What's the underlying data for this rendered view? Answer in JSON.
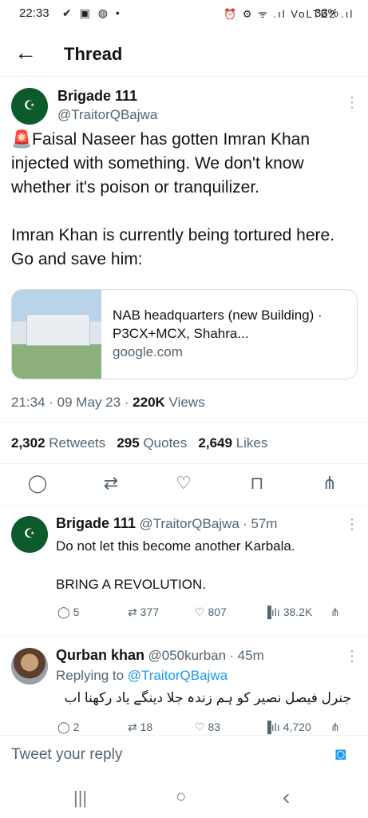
{
  "status_bar": {
    "time": "22:33",
    "left_icons": "✔ ▣ ◍ •",
    "right_icons": "⏰ ⚙ ᯤ .ıl VoLTE2 .ıl",
    "battery": "33%"
  },
  "header": {
    "back_icon": "arrow-left",
    "title": "Thread"
  },
  "main_tweet": {
    "avatar_text": "☪",
    "name": "Brigade 111",
    "handle": "@TraitorQBajwa",
    "text": "🚨Faisal Naseer has gotten Imran Khan injected with something. We don't know whether it's poison or tranquilizer.\n\nImran Khan is currently being tortured here. Go and save him:",
    "card": {
      "title": "NAB headquarters (new Building) · P3CX+MCX, Shahra...",
      "domain": "google.com"
    },
    "time": "21:34",
    "date": "09 May 23",
    "views_count": "220K",
    "views_label": "Views",
    "retweets_count": "2,302",
    "retweets_label": "Retweets",
    "quotes_count": "295",
    "quotes_label": "Quotes",
    "likes_count": "2,649",
    "likes_label": "Likes"
  },
  "reply1": {
    "name": "Brigade 111",
    "handle": "@TraitorQBajwa",
    "age": "57m",
    "text": "Do not let this become another Karbala.\n\nBRING A REVOLUTION.",
    "replies": "5",
    "retweets": "377",
    "likes": "807",
    "views": "38.2K"
  },
  "reply2": {
    "name": "Qurban khan",
    "handle": "@050kurban",
    "age": "45m",
    "replying_label": "Replying to",
    "replying_handle": "@TraitorQBajwa",
    "text": "جنرل فیصل نصیر کو ہم زندہ جلا دینگے یاد رکھنا اب",
    "replies": "2",
    "retweets": "18",
    "likes": "83",
    "views": "4,720"
  },
  "composer": {
    "placeholder": "Tweet your reply"
  },
  "nav": {
    "recents": "|||",
    "home": "○",
    "back": "‹"
  }
}
